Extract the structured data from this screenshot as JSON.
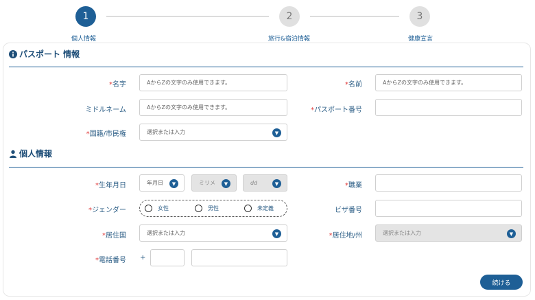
{
  "stepper": {
    "steps": [
      {
        "number": "1",
        "label": "個人情報",
        "state": "active"
      },
      {
        "number": "2",
        "label": "旅行&宿泊情報",
        "state": "inactive"
      },
      {
        "number": "3",
        "label": "健康宣言",
        "state": "inactive"
      }
    ]
  },
  "passport_section": {
    "icon": "info-icon",
    "title": "パスポート 情報",
    "given_name": {
      "label": "名字",
      "required_mark": "*",
      "placeholder": "AからZの文字のみ使用できます。"
    },
    "surname": {
      "label": "名前",
      "required_mark": "*",
      "placeholder": "AからZの文字のみ使用できます。"
    },
    "middle_name": {
      "label": "ミドルネーム",
      "placeholder": "AからZの文字のみ使用できます。"
    },
    "passport_number": {
      "label": "パスポート番号",
      "required_mark": "*",
      "value": ""
    },
    "nationality": {
      "label": "国籍/市民権",
      "required_mark": "*",
      "placeholder": "選択または入力"
    }
  },
  "personal_section": {
    "icon": "person-icon",
    "title": "個人情報",
    "birth_date": {
      "label": "生年月日",
      "required_mark": "*",
      "year_placeholder": "年月日",
      "month_placeholder": "ミリメ",
      "day_placeholder": "dd"
    },
    "occupation": {
      "label": "職業",
      "required_mark": "*",
      "value": ""
    },
    "gender": {
      "label": "ジェンダー",
      "required_mark": "*",
      "options": [
        "女性",
        "男性",
        "未定義"
      ]
    },
    "visa_number": {
      "label": "ビザ番号",
      "value": ""
    },
    "country_of_residence": {
      "label": "居住国",
      "required_mark": "*",
      "placeholder": "選択または入力"
    },
    "state_of_residence": {
      "label": "居住地/州",
      "required_mark": "*",
      "placeholder": "選択または入力"
    },
    "phone": {
      "label": "電話番号",
      "required_mark": "*",
      "prefix": "+",
      "code": "",
      "number": ""
    }
  },
  "actions": {
    "continue_label": "続ける"
  },
  "colors": {
    "primary": "#1e5f96",
    "required": "#e03c3c",
    "label": "#2c5e86"
  }
}
